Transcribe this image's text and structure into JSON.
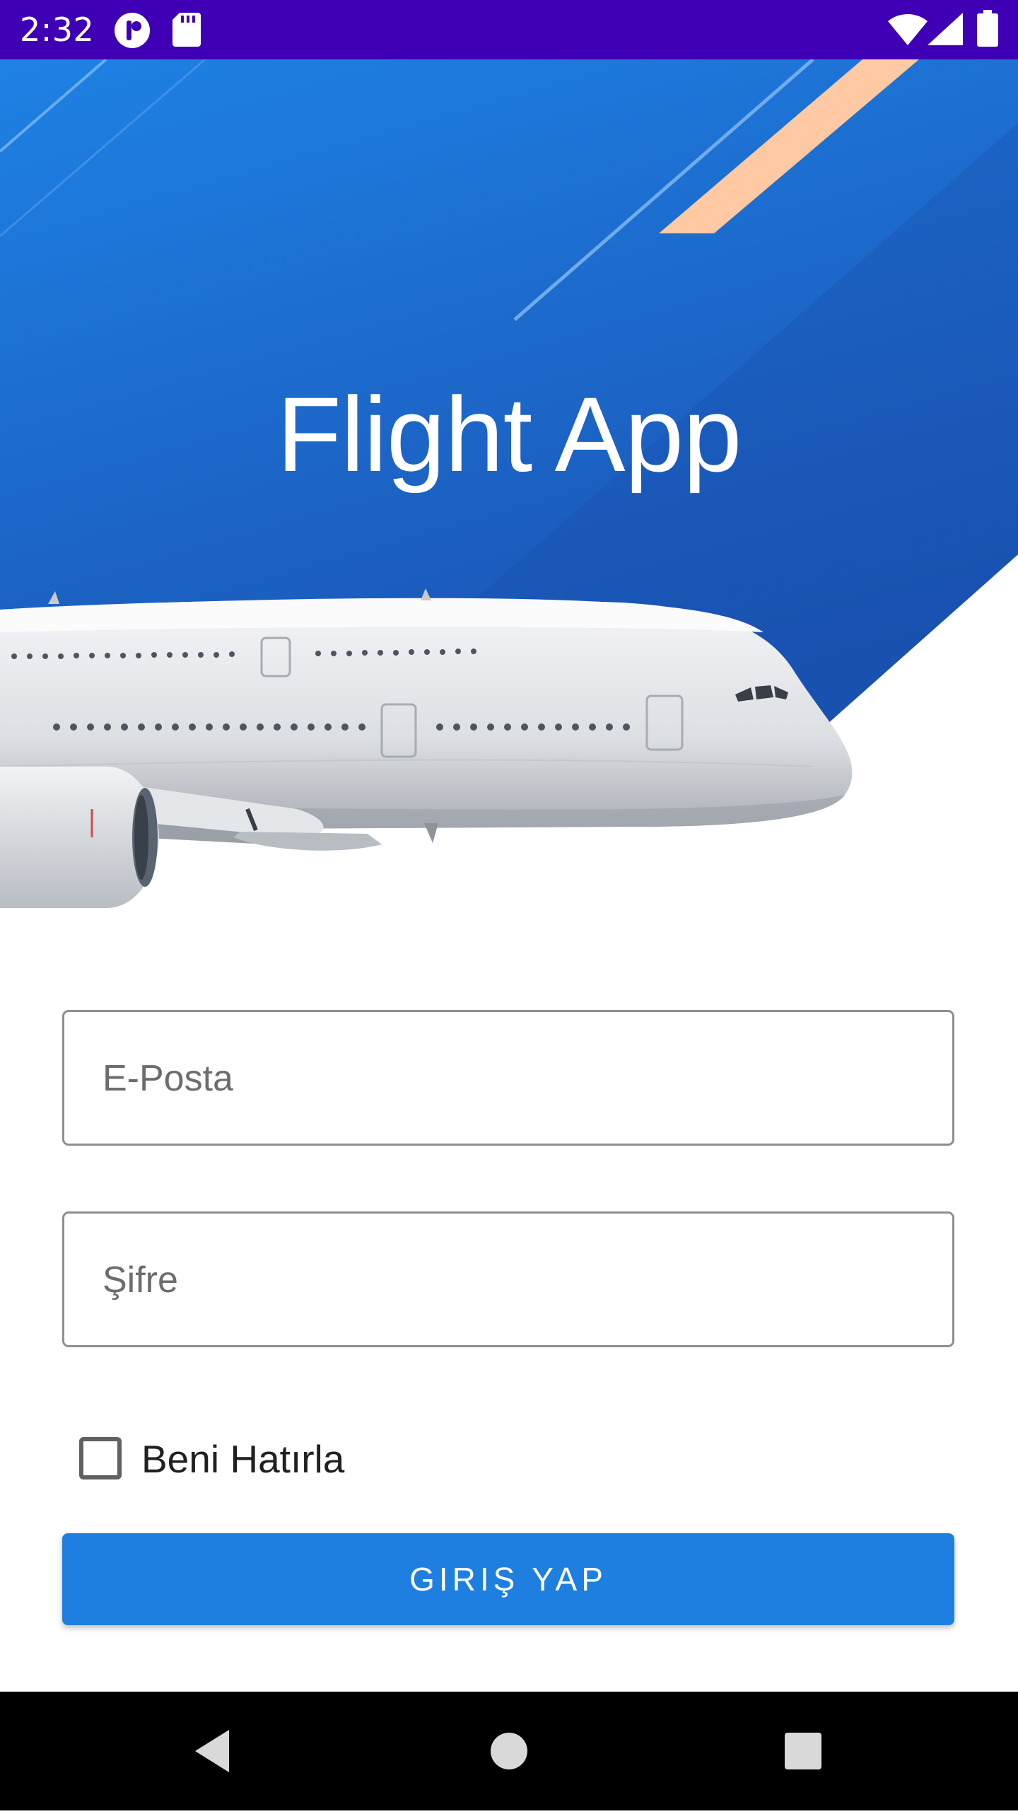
{
  "status_bar": {
    "time": "2:32",
    "icons": [
      "notification-app-icon",
      "sd-card-icon",
      "wifi-icon",
      "cellular-signal-icon",
      "battery-icon"
    ],
    "background": "#3f00b5"
  },
  "hero": {
    "title": "Flight App",
    "gradient_top": "#1e80e2",
    "gradient_bottom": "#1a56b8",
    "accent_stripe_color": "#ffc9a3",
    "image": "airplane"
  },
  "form": {
    "email": {
      "placeholder": "E-Posta",
      "value": ""
    },
    "password": {
      "placeholder": "Şifre",
      "value": ""
    },
    "remember_me": {
      "label": "Beni Hatırla",
      "checked": false
    },
    "login_button": {
      "label": "GIRIŞ YAP",
      "color": "#1e7fe0"
    }
  },
  "nav_bar": {
    "buttons": [
      "back-icon",
      "home-icon",
      "recents-icon"
    ]
  }
}
